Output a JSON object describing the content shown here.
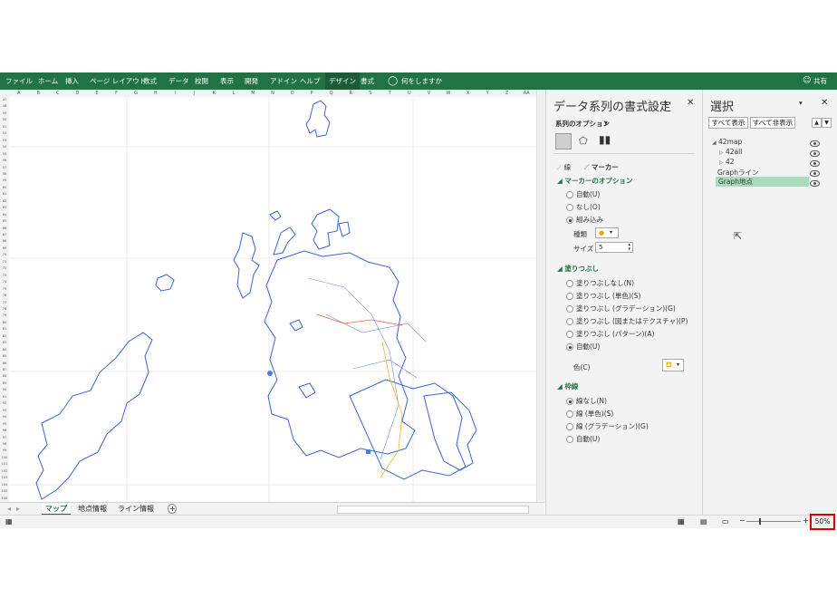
{
  "ribbon": {
    "tabs": [
      "ファイル",
      "ホーム",
      "挿入",
      "ページ レイアウト",
      "数式",
      "データ",
      "校閲",
      "表示",
      "開発",
      "アドイン",
      "ヘルプ",
      "デザイン",
      "書式"
    ],
    "tell_me": "何をしますか",
    "share": "共有",
    "accent": "#217346"
  },
  "sheet": {
    "col_headers": [
      "A",
      "B",
      "C",
      "D",
      "E",
      "F",
      "G",
      "H",
      "I",
      "J",
      "K",
      "L",
      "M",
      "N",
      "O",
      "P",
      "Q",
      "R",
      "S",
      "T",
      "U",
      "V",
      "W",
      "X",
      "Y",
      "Z",
      "AA"
    ],
    "row_start": 47,
    "row_end": 106,
    "tabs": [
      "マップ",
      "地点情報",
      "ライン情報"
    ],
    "active_tab": "マップ",
    "add_sheet": "+"
  },
  "format_pane": {
    "title": "データ系列の書式設定",
    "series_options": "系列のオプション",
    "tab_line": "線",
    "tab_marker": "マーカー",
    "marker_options": "マーカーのオプション",
    "marker_radios": [
      "自動(U)",
      "なし(O)",
      "組み込み"
    ],
    "marker_selected": "組み込み",
    "type_label": "種類",
    "size_label": "サイズ",
    "size_value": "5",
    "fill_heading": "塗りつぶし",
    "fill_radios": [
      "塗りつぶしなし(N)",
      "塗りつぶし (単色)(S)",
      "塗りつぶし (グラデーション)(G)",
      "塗りつぶし (図またはテクスチャ)(P)",
      "塗りつぶし (パターン)(A)",
      "自動(U)"
    ],
    "fill_selected": "自動(U)",
    "color_label": "色(C)",
    "border_heading": "枠線",
    "border_radios": [
      "線なし(N)",
      "線 (単色)(S)",
      "線 (グラデーション)(G)",
      "自動(U)"
    ],
    "border_selected": "線なし(N)"
  },
  "selection_pane": {
    "title": "選択",
    "show_all": "すべて表示",
    "hide_all": "すべて非表示",
    "items": [
      {
        "label": "42map",
        "indent": 0,
        "expander": "◢",
        "selected": false
      },
      {
        "label": "42all",
        "indent": 1,
        "expander": "▷",
        "selected": false
      },
      {
        "label": "42",
        "indent": 1,
        "expander": "▷",
        "selected": false
      },
      {
        "label": "Graphライン",
        "indent": 0,
        "expander": "",
        "selected": false
      },
      {
        "label": "Graph地点",
        "indent": 0,
        "expander": "",
        "selected": true
      }
    ],
    "selected_color": "#a8dcbc"
  },
  "status": {
    "zoom": "50%",
    "zoom_minus": "−",
    "zoom_plus": "+"
  }
}
